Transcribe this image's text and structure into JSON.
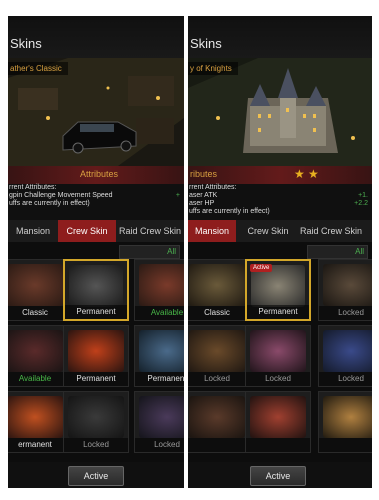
{
  "left_panel": {
    "title": "Skins",
    "scene_name": "ather's Classic",
    "attributes_label": "Attributes",
    "current_attributes": "rrent Attributes:",
    "attribute_lines": [
      {
        "name": "gpin Challenge Movement Speed",
        "value": "+"
      },
      {
        "name": "uffs are currently in effect)",
        "value": ""
      }
    ],
    "tabs": [
      {
        "label": "Mansion",
        "selected": false
      },
      {
        "label": "Crew Skin",
        "selected": true
      },
      {
        "label": "Raid Crew Skin",
        "selected": false
      }
    ],
    "filter_label": "All",
    "cells": [
      {
        "status": "Classic",
        "tone": "white",
        "selected": false
      },
      {
        "status": "Permanent",
        "tone": "white",
        "selected": true
      },
      {
        "status": "Available",
        "tone": "green",
        "selected": false
      },
      {
        "status": "Available",
        "tone": "green",
        "selected": false
      },
      {
        "status": "Permanent",
        "tone": "white",
        "selected": false
      },
      {
        "status": "Permanent",
        "tone": "white",
        "selected": false
      },
      {
        "status": "ermanent",
        "tone": "white",
        "selected": false
      },
      {
        "status": "Locked",
        "tone": "gray",
        "selected": false
      },
      {
        "status": "Locked",
        "tone": "gray",
        "selected": false
      }
    ],
    "active_button": "Active"
  },
  "right_panel": {
    "title": "Skins",
    "scene_name": "y of Knights",
    "attributes_label": "ributes",
    "current_attributes": "rrent Attributes:",
    "attribute_lines": [
      {
        "name": "aser ATK",
        "value": "+1."
      },
      {
        "name": "aser HP",
        "value": "+2.2"
      },
      {
        "name": "uffs are currently in effect)",
        "value": ""
      }
    ],
    "tabs": [
      {
        "label": "Mansion",
        "selected": true
      },
      {
        "label": "Crew Skin",
        "selected": false
      },
      {
        "label": "Raid Crew Skin",
        "selected": false
      }
    ],
    "filter_label": "All",
    "badge": "Active",
    "cells": [
      {
        "status": "Classic",
        "tone": "white",
        "selected": false
      },
      {
        "status": "Permanent",
        "tone": "white",
        "selected": true
      },
      {
        "status": "Locked",
        "tone": "gray",
        "selected": false
      },
      {
        "status": "Locked",
        "tone": "gray",
        "selected": false
      },
      {
        "status": "Locked",
        "tone": "gray",
        "selected": false
      },
      {
        "status": "Locked",
        "tone": "gray",
        "selected": false
      },
      {
        "status": "",
        "tone": "gray",
        "selected": false
      },
      {
        "status": "",
        "tone": "gray",
        "selected": false
      },
      {
        "status": "",
        "tone": "gray",
        "selected": false
      }
    ],
    "active_button": "Active"
  },
  "colors": {
    "selected_tab": "#8e1d1d",
    "selected_border": "#d3a72a",
    "available_text": "#48b848",
    "stars": "#e8b020"
  }
}
